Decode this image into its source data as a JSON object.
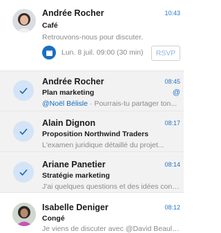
{
  "messages": [
    {
      "sender": "Andrée Rocher",
      "subject": "Café",
      "preview": "Retrouvons-nous pour discuter.",
      "time": "10:43",
      "meeting": {
        "text": "Lun. 8 juil. 09:00 (30 min)",
        "rsvp_label": "RSVP"
      },
      "avatar": "avatar-photo"
    },
    {
      "sender": "Andrée Rocher",
      "subject": "Plan marketing",
      "mention": "@Noël Bélisle",
      "preview": " · Pourrais-tu partager ton...",
      "time": "08:45",
      "mention_icon": "@",
      "selected": true
    },
    {
      "sender": "Alain Dignon",
      "subject": "Proposition Northwind Traders",
      "preview": "L'examen juridique détaillé du projet...",
      "time": "08:17",
      "selected": true
    },
    {
      "sender": "Ariane Panetier",
      "subject": "Stratégie marketing",
      "preview": "J'ai quelques questions et des idées conc...",
      "time": "08:14",
      "selected": true
    },
    {
      "sender": "Isabelle Deniger",
      "subject": "Congé",
      "preview": "Je viens de discuter avec @David Beaulieu...",
      "time": "08:12",
      "avatar": "avatar-photo"
    }
  ],
  "colors": {
    "accent": "#0f6cbd",
    "selected_bg": "#f2f2f2",
    "check_bg": "#d4e4f6"
  },
  "icons": {
    "selected": "checkmark-icon",
    "meeting": "calendar-icon"
  }
}
